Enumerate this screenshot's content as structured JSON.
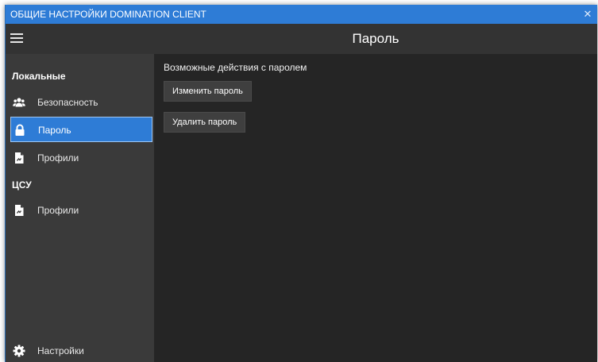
{
  "window": {
    "title": "ОБЩИЕ НАСТРОЙКИ DOMINATION CLIENT",
    "close_glyph": "✕"
  },
  "header": {
    "title": "Пароль",
    "menu_icon": "hamburger-icon"
  },
  "sidebar": {
    "sections": [
      {
        "title": "Локальные",
        "items": [
          {
            "label": "Безопасность",
            "icon": "users-icon",
            "active": false
          },
          {
            "label": "Пароль",
            "icon": "lock-icon",
            "active": true
          },
          {
            "label": "Профили",
            "icon": "file-icon",
            "active": false
          }
        ]
      },
      {
        "title": "ЦСУ",
        "items": [
          {
            "label": "Профили",
            "icon": "file-icon",
            "active": false
          }
        ]
      }
    ],
    "footer_item": {
      "label": "Настройки",
      "icon": "gear-icon"
    }
  },
  "content": {
    "heading": "Возможные действия с паролем",
    "buttons": [
      {
        "label": "Изменить пароль"
      },
      {
        "label": "Удалить пароль"
      }
    ]
  },
  "colors": {
    "accent": "#2e7cd6",
    "sidebar_bg": "#3a3a3a",
    "content_bg": "#252525",
    "header_bg": "#333333"
  }
}
